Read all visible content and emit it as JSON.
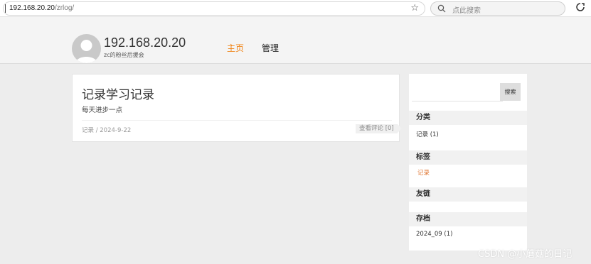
{
  "browser": {
    "url_host": "192.168.20.20",
    "url_path": "/zrlog/",
    "search_placeholder": "点此搜索"
  },
  "header": {
    "site_title": "192.168.20.20",
    "site_subtitle": "zc的粉丝后援会",
    "nav": [
      {
        "label": "主页",
        "active": true,
        "color": "#f08519"
      },
      {
        "label": "管理",
        "active": false
      }
    ]
  },
  "post": {
    "title": "记录学习记录",
    "summary": "每天进步一点",
    "meta": "记录 / 2024-9-22",
    "comments_label": "查看评论 [0]"
  },
  "sidebar": {
    "search_button": "搜索",
    "sections": [
      {
        "title": "分类",
        "items": [
          "记录 (1)"
        ]
      },
      {
        "title": "标签",
        "items": [
          "记录"
        ]
      },
      {
        "title": "友链",
        "items": []
      },
      {
        "title": "存档",
        "items": [
          "2024_09 (1)"
        ]
      }
    ]
  },
  "watermark": "CSDN @小蘑菇的日记",
  "colors": {
    "accent": "#f08519",
    "tag": "#e07b39",
    "page_bg": "#ededed"
  }
}
